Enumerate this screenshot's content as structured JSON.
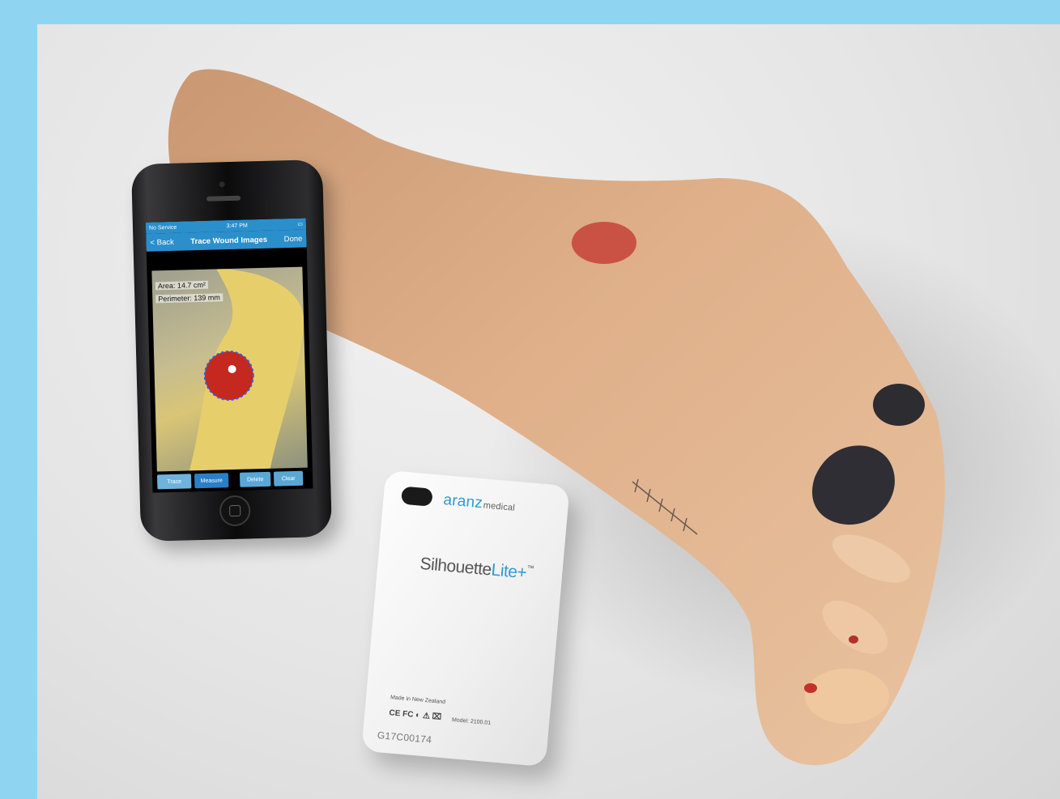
{
  "phone_screen": {
    "status_left": "No Service",
    "status_time": "3:47 PM",
    "back_label": "< Back",
    "title": "Trace Wound Images",
    "done_label": "Done",
    "area": "Area: 14.7 cm²",
    "perimeter": "Perimeter: 139 mm",
    "toolbar": [
      "Trace",
      "Measure",
      "Delete",
      "Clear"
    ]
  },
  "device_case": {
    "brand_main": "aranz",
    "brand_sub": "medical",
    "product_main": "Silhouette",
    "product_lite": "Lite+",
    "product_tm": "™",
    "made_in": "Made in New Zealand",
    "cert_marks": "CE FC ◐ ⚠ ⌧",
    "model": "Model: 2100.01",
    "serial": "G17C00174"
  },
  "colors": {
    "frame": "#8fd5f2",
    "app_bar": "#2a8fcb",
    "brand_blue": "#2f9bd2",
    "skin": "#e2b48c"
  }
}
